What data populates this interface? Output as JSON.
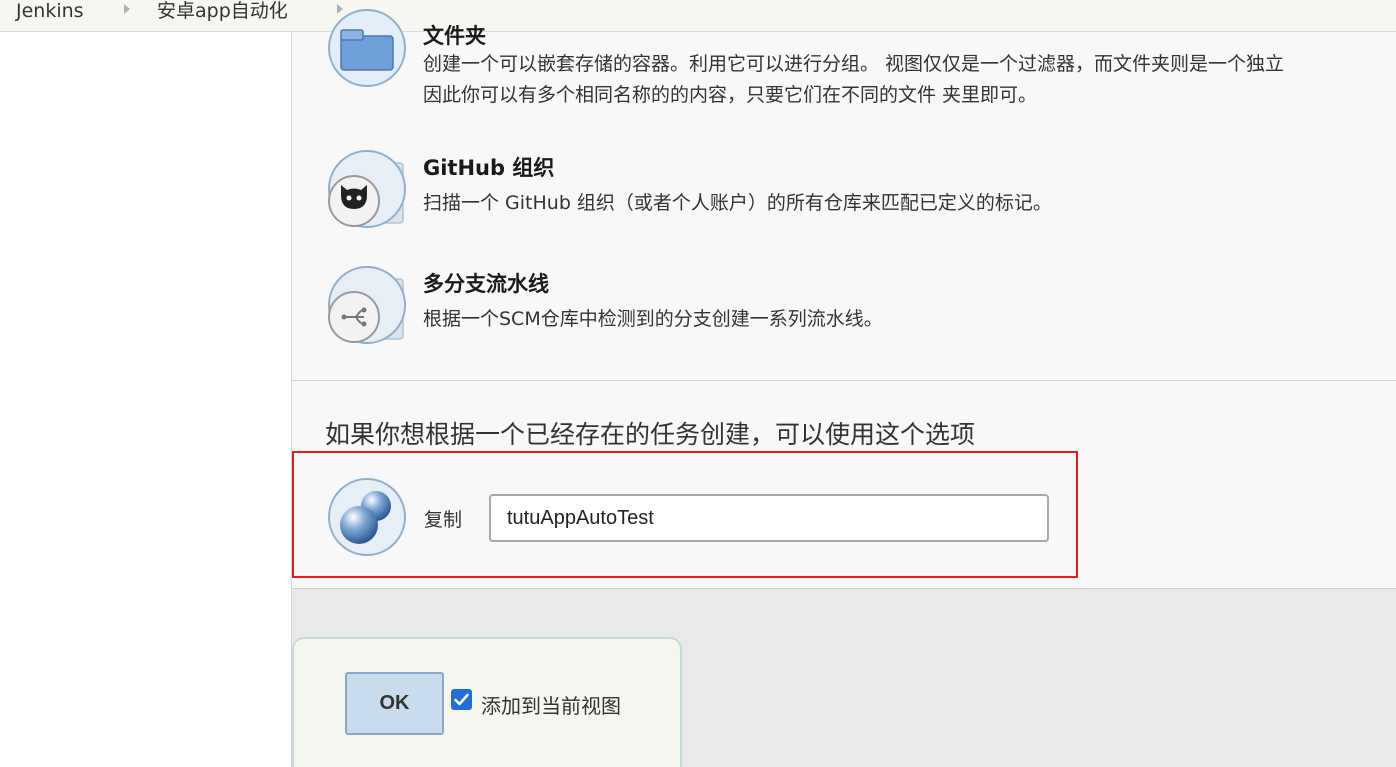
{
  "breadcrumb": {
    "items": [
      "Jenkins",
      "安卓app自动化"
    ]
  },
  "item_types": [
    {
      "icon": "folder-icon",
      "title": "文件夹",
      "description_lines": [
        "创建一个可以嵌套存储的容器。利用它可以进行分组。 视图仅仅是一个过滤器，而文件夹则是一个独立",
        "因此你可以有多个相同名称的的内容，只要它们在不同的文件 夹里即可。"
      ]
    },
    {
      "icon": "github-octocat-icon",
      "title": "GitHub 组织",
      "description_lines": [
        "扫描一个 GitHub 组织（或者个人账户）的所有仓库来匹配已定义的标记。"
      ]
    },
    {
      "icon": "branch-icon",
      "title": "多分支流水线",
      "description_lines": [
        "根据一个SCM仓库中检测到的分支创建一系列流水线。"
      ]
    }
  ],
  "copy_section": {
    "heading": "如果你想根据一个已经存在的任务创建，可以使用这个选项",
    "label": "复制",
    "input_value": "tutuAppAutoTest",
    "highlight_color": "#e02020"
  },
  "footer": {
    "ok_label": "OK",
    "add_to_view_checked": true,
    "add_to_view_label": "添加到当前视图"
  },
  "colors": {
    "accent_blue": "#1f6fd6",
    "ok_button_bg": "#c9dcee"
  }
}
